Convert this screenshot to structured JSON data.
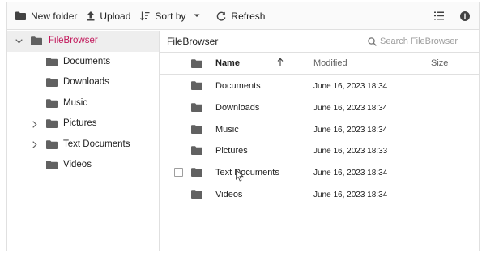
{
  "toolbar": {
    "new_folder_label": "New folder",
    "upload_label": "Upload",
    "sort_by_label": "Sort by",
    "refresh_label": "Refresh",
    "icons": [
      "new-folder-icon",
      "upload-icon",
      "sort-icon",
      "chevron-down-icon",
      "refresh-icon",
      "view-toggle-icon",
      "details-icon"
    ]
  },
  "navigation": {
    "root": "FileBrowser",
    "items": [
      {
        "label": "Documents",
        "expandable": false
      },
      {
        "label": "Downloads",
        "expandable": false
      },
      {
        "label": "Music",
        "expandable": false
      },
      {
        "label": "Pictures",
        "expandable": true
      },
      {
        "label": "Text Documents",
        "expandable": true
      },
      {
        "label": "Videos",
        "expandable": false
      }
    ]
  },
  "address_bar": {
    "path": "FileBrowser",
    "search_placeholder": "Search FileBrowser"
  },
  "grid": {
    "columns": {
      "name": "Name",
      "modified": "Modified",
      "size": "Size"
    },
    "sort_column": "Name",
    "sort_direction": "ascending",
    "rows": [
      {
        "name": "Documents",
        "modified": "June 16, 2023 18:34",
        "size": ""
      },
      {
        "name": "Downloads",
        "modified": "June 16, 2023 18:34",
        "size": ""
      },
      {
        "name": "Music",
        "modified": "June 16, 2023 18:34",
        "size": ""
      },
      {
        "name": "Pictures",
        "modified": "June 16, 2023 18:33",
        "size": ""
      },
      {
        "name": "Text Documents",
        "modified": "June 16, 2023 18:34",
        "size": "",
        "hovered": true
      },
      {
        "name": "Videos",
        "modified": "June 16, 2023 18:34",
        "size": ""
      }
    ]
  },
  "colors": {
    "accent": "#c2185b",
    "folder": "#616161",
    "border": "#e0e0e0",
    "selected_bg": "#eeeeee"
  }
}
